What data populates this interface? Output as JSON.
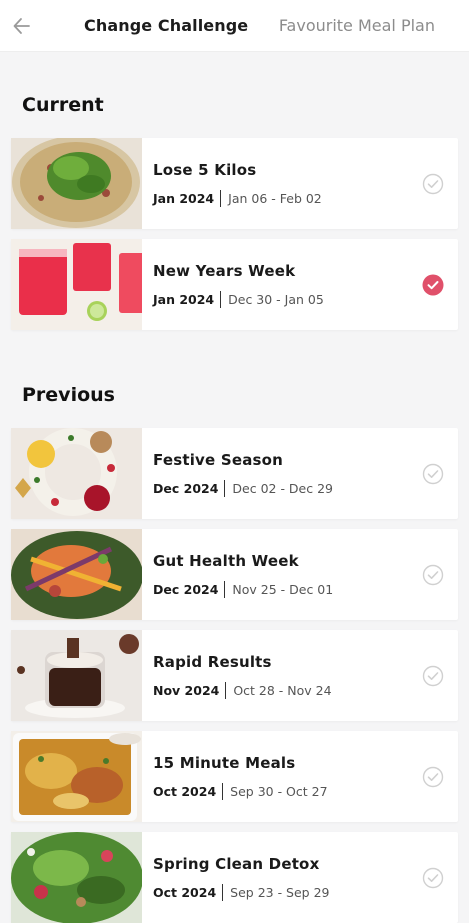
{
  "header": {
    "back_icon": "back-arrow-icon",
    "tabs": [
      {
        "label": "Change Challenge",
        "active": true
      },
      {
        "label": "Favourite Meal Plan",
        "active": false
      }
    ]
  },
  "current": {
    "title": "Current",
    "items": [
      {
        "name": "Lose 5 Kilos",
        "month": "Jan 2024",
        "range": "Jan 06 - Feb 02",
        "selected": false,
        "image": "pizza-salad-image"
      },
      {
        "name": "New Years Week",
        "month": "Jan 2024",
        "range": "Dec 30 - Jan 05",
        "selected": true,
        "image": "red-drinks-image"
      }
    ]
  },
  "previous": {
    "title": "Previous",
    "items": [
      {
        "name": "Festive Season",
        "month": "Dec 2024",
        "range": "Dec 02 - Dec 29",
        "selected": false,
        "image": "festive-wreath-image"
      },
      {
        "name": "Gut Health Week",
        "month": "Dec 2024",
        "range": "Nov 25 - Dec 01",
        "selected": false,
        "image": "salmon-salad-image"
      },
      {
        "name": "Rapid Results",
        "month": "Nov 2024",
        "range": "Oct 28 - Nov 24",
        "selected": false,
        "image": "chocolate-dessert-image"
      },
      {
        "name": "15 Minute Meals",
        "month": "Oct 2024",
        "range": "Sep 30 - Oct 27",
        "selected": false,
        "image": "lasagna-image"
      },
      {
        "name": "Spring Clean Detox",
        "month": "Oct 2024",
        "range": "Sep 23 - Sep 29",
        "selected": false,
        "image": "green-salad-image"
      }
    ]
  },
  "colors": {
    "accent": "#e0506a",
    "check_inactive": "#d0d0d0",
    "background": "#f5f5f6"
  }
}
